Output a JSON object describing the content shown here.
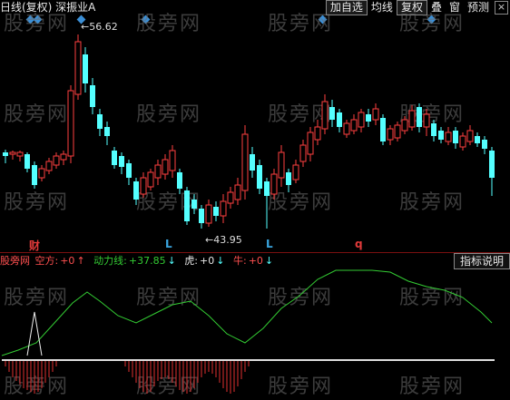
{
  "header": {
    "title": "日线(复权)  深振业A",
    "toolbar": [
      "加自选",
      "均线",
      "复权",
      "叠",
      "窗",
      "预测"
    ],
    "close": "×"
  },
  "watermark": "股旁网",
  "price_marks": {
    "high": "56.62",
    "low": "43.95"
  },
  "event_labels": {
    "cai": "财",
    "l1": "L",
    "l2": "L",
    "q": "q"
  },
  "indicator": {
    "name": "股旁网",
    "kong_label": "空方:",
    "kong_value": "+0",
    "dongli_label": "动力线:",
    "dongli_value": "+37.85",
    "hu_label": "虎:",
    "hu_value": "+0",
    "niu_label": "牛:",
    "niu_value": "+0",
    "help_button": "指标说明"
  },
  "colors": {
    "up": "#ff4040",
    "down": "#54ffff",
    "ma_line": "#66dd44",
    "dongli": "#33cc33",
    "kong_red": "#e03030",
    "diamond": "#3b8fd6"
  }
}
